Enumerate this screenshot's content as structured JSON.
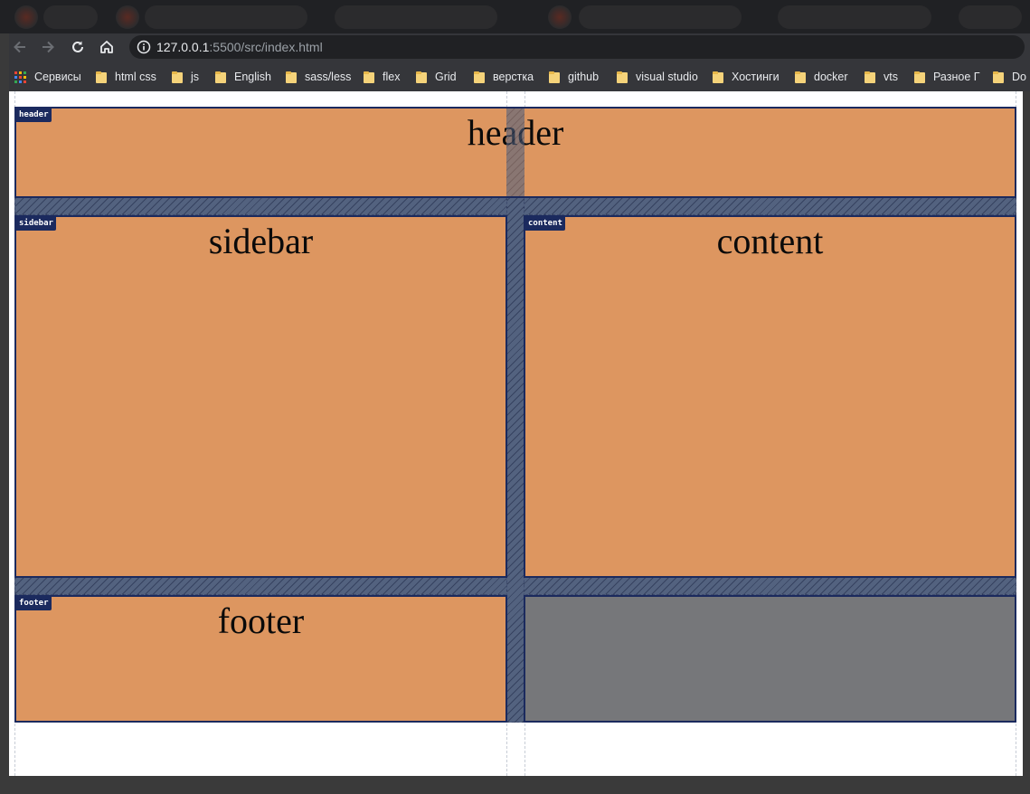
{
  "browser": {
    "url_host": "127.0.0.1",
    "url_rest": ":5500/src/index.html",
    "bookmarks": [
      {
        "label": "Сервисы",
        "icon": "apps-grid-icon"
      },
      {
        "label": "html css",
        "icon": "folder-icon"
      },
      {
        "label": "js",
        "icon": "folder-icon"
      },
      {
        "label": "English",
        "icon": "folder-icon"
      },
      {
        "label": "sass/less",
        "icon": "folder-icon"
      },
      {
        "label": "flex",
        "icon": "folder-icon"
      },
      {
        "label": "Grid",
        "icon": "folder-icon"
      },
      {
        "label": "верстка",
        "icon": "folder-icon"
      },
      {
        "label": "github",
        "icon": "folder-icon"
      },
      {
        "label": "visual studio",
        "icon": "folder-icon"
      },
      {
        "label": "Хостинги",
        "icon": "folder-icon"
      },
      {
        "label": "docker",
        "icon": "folder-icon"
      },
      {
        "label": "vts",
        "icon": "folder-icon"
      },
      {
        "label": "Разное Г",
        "icon": "folder-icon"
      },
      {
        "label": "Do",
        "icon": "folder-icon"
      }
    ]
  },
  "grid": {
    "header": {
      "badge": "header",
      "title": "header"
    },
    "sidebar": {
      "badge": "sidebar",
      "title": "sidebar"
    },
    "content": {
      "badge": "content",
      "title": "content"
    },
    "footer": {
      "badge": "footer",
      "title": "footer"
    }
  },
  "colors": {
    "cell": "#dd9660",
    "cell_border": "#1b2a5e",
    "gap": "#53627f",
    "empty_cell": "#76777a"
  }
}
